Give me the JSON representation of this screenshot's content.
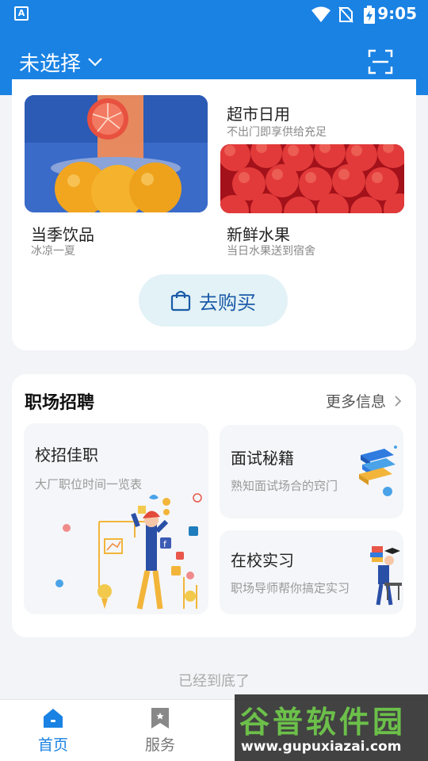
{
  "status_bar": {
    "app_indicator": "A",
    "time": "9:05"
  },
  "header": {
    "location_label": "未选择",
    "dropdown_icon": "chevron-down-icon",
    "scan_icon": "scan-icon"
  },
  "shop": {
    "tiles": [
      {
        "title": "超市日用",
        "subtitle": "不出门即享供给充足"
      },
      {
        "title": "当季饮品",
        "subtitle": "冰凉一夏"
      },
      {
        "title": "新鲜水果",
        "subtitle": "当日水果送到宿舍"
      }
    ],
    "buy_button": "去购买",
    "buy_icon": "shopping-bag-icon"
  },
  "jobs": {
    "section_title": "职场招聘",
    "more_label": "更多信息",
    "cards": [
      {
        "title": "校招佳职",
        "subtitle": "大厂职位时间一览表"
      },
      {
        "title": "面试秘籍",
        "subtitle": "熟知面试场合的窍门"
      },
      {
        "title": "在校实习",
        "subtitle": "职场导师帮你搞定实习"
      }
    ]
  },
  "end_text": "已经到底了",
  "tabbar": {
    "items": [
      {
        "label": "首页",
        "icon": "home-icon",
        "active": true
      },
      {
        "label": "服务",
        "icon": "bookmark-icon",
        "active": false
      }
    ]
  },
  "watermark": {
    "text": "谷普软件园",
    "url": "www.gupuxiazai.com"
  },
  "colors": {
    "primary": "#1a82e3",
    "buy_button_bg": "#e3f2f6",
    "background": "#f2f4f7"
  }
}
